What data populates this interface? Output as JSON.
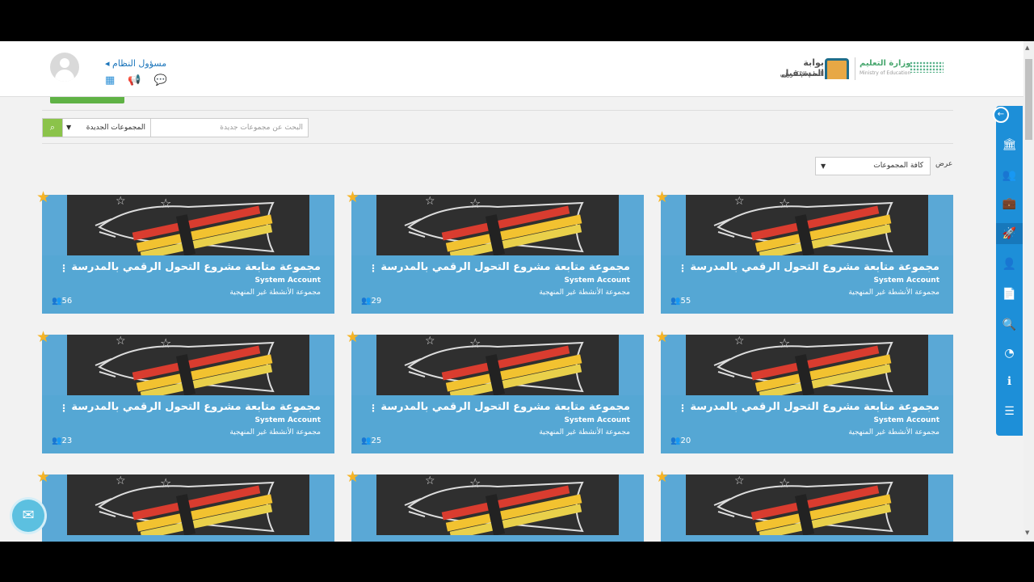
{
  "header": {
    "user_name": "مسؤول النظام ◂",
    "portal_title": "بوابة المستقبل",
    "portal_subtitle": "التعلم الإلكتروني",
    "ministry_name": "وزارة التعليم",
    "ministry_en": "Ministry of Education",
    "icons": [
      "apps-grid-icon",
      "megaphone-icon",
      "chat-icon"
    ]
  },
  "search": {
    "placeholder": "البحث عن مجموعات جديدة",
    "select_value": "المجموعات الجديدة",
    "button_icon": "search-icon"
  },
  "filter": {
    "label": "عرض",
    "value": "كافة المجموعات"
  },
  "cards": [
    {
      "title": "مجموعة متابعة مشروع التحول الرقمي بالمدرسة",
      "owner": "System Account",
      "type": "مجموعة الأنشطة غير المنهجية",
      "count": "56"
    },
    {
      "title": "مجموعة متابعة مشروع التحول الرقمي بالمدرسة",
      "owner": "System Account",
      "type": "مجموعة الأنشطة غير المنهجية",
      "count": "29"
    },
    {
      "title": "مجموعة متابعة مشروع التحول الرقمي بالمدرسة",
      "owner": "System Account",
      "type": "مجموعة الأنشطة غير المنهجية",
      "count": "55"
    },
    {
      "title": "مجموعة متابعة مشروع التحول الرقمي بالمدرسة",
      "owner": "System Account",
      "type": "مجموعة الأنشطة غير المنهجية",
      "count": "23"
    },
    {
      "title": "مجموعة متابعة مشروع التحول الرقمي بالمدرسة",
      "owner": "System Account",
      "type": "مجموعة الأنشطة غير المنهجية",
      "count": "25"
    },
    {
      "title": "مجموعة متابعة مشروع التحول الرقمي بالمدرسة",
      "owner": "System Account",
      "type": "مجموعة الأنشطة غير المنهجية",
      "count": "20"
    }
  ],
  "sidebar_icons": [
    "institution-icon",
    "users-icon",
    "briefcase-icon",
    "rocket-icon",
    "user-settings-icon",
    "report-icon",
    "user-search-icon",
    "pie-chart-icon",
    "info-icon",
    "server-icon"
  ],
  "colors": {
    "card_blue": "#55a7d4",
    "sidebar_blue": "#1d8fd8",
    "accent_green": "#5fb245",
    "star_gold": "#f6b426"
  }
}
